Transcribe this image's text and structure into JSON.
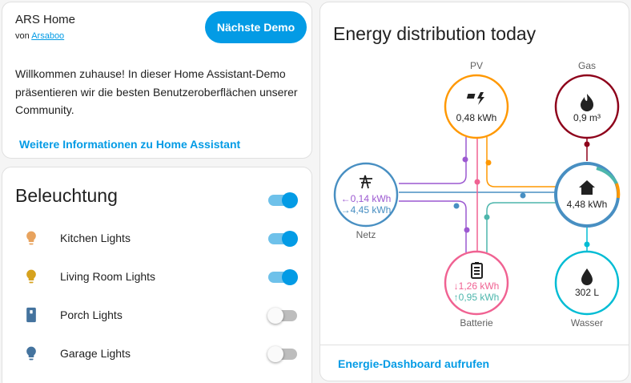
{
  "demo": {
    "title": "ARS Home",
    "author_prefix": "von",
    "author_name": "Arsaboo",
    "next_button": "Nächste Demo",
    "description": "Willkommen zuhause! In dieser Home Assistant-Demo präsentieren wir die besten Benutzeroberflächen unserer Community.",
    "more_info_link": "Weitere Informationen zu Home Assistant"
  },
  "lights": {
    "title": "Beleuchtung",
    "master_on": true,
    "items": [
      {
        "label": "Kitchen Lights",
        "on": true,
        "icon": "bulb-icon",
        "icon_color": "#e8a35e"
      },
      {
        "label": "Living Room Lights",
        "on": true,
        "icon": "bulb-icon",
        "icon_color": "#d6a21e"
      },
      {
        "label": "Porch Lights",
        "on": false,
        "icon": "light-switch-icon",
        "icon_color": "#44739e"
      },
      {
        "label": "Garage Lights",
        "on": false,
        "icon": "bulb-icon",
        "icon_color": "#44739e"
      }
    ]
  },
  "energy": {
    "title": "Energy distribution today",
    "dashboard_link": "Energie-Dashboard aufrufen",
    "nodes": {
      "pv": {
        "label": "PV",
        "value": "0,48 kWh",
        "color": "#ff9800",
        "icon": "solar-power-icon"
      },
      "gas": {
        "label": "Gas",
        "value": "0,9 m³",
        "color": "#8e021b",
        "icon": "fire-icon"
      },
      "grid": {
        "label": "Netz",
        "import": "0,14 kWh",
        "export": "4,45 kWh",
        "import_arrow": "←",
        "export_arrow": "→",
        "color": "#488fc2",
        "icon": "transmission-tower-icon"
      },
      "home": {
        "label": "",
        "value": "4,48 kWh",
        "color": "#488fc2",
        "icon": "home-icon"
      },
      "battery": {
        "label": "Batterie",
        "in": "1,26 kWh",
        "out": "0,95 kWh",
        "in_arrow": "↓",
        "out_arrow": "↑",
        "color": "#f06292",
        "icon": "battery-icon"
      },
      "water": {
        "label": "Wasser",
        "value": "302 L",
        "color": "#00bcd4",
        "icon": "water-icon"
      }
    },
    "flow_colors": {
      "grid_to_home": "#488fc2",
      "solar": "#ff9800",
      "battery_out": "#4db6ac",
      "battery_in": "#f06292",
      "grid_in": "#9c59d1",
      "gas": "#8e021b",
      "water": "#00bcd4"
    }
  }
}
